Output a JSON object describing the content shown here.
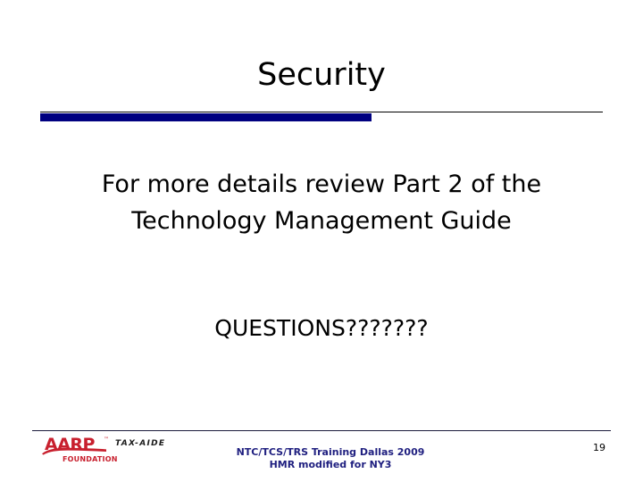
{
  "slide": {
    "title": "Security",
    "body_lines": [
      "For more details review Part 2 of the",
      "Technology Management Guide"
    ],
    "questions": "QUESTIONS???????",
    "accent_bar_color": "#000080",
    "rule_color": "#000000"
  },
  "footer": {
    "logo": {
      "brand": "AARP",
      "trademark": "™",
      "sub_brand": "FOUNDATION",
      "program": "TAX-AIDE",
      "brand_color": "#c8202e",
      "program_color": "#1a1a1a"
    },
    "center_lines": [
      "NTC/TCS/TRS Training Dallas 2009",
      "HMR modified for NY3"
    ],
    "center_color": "#202080",
    "page_number": "19"
  }
}
